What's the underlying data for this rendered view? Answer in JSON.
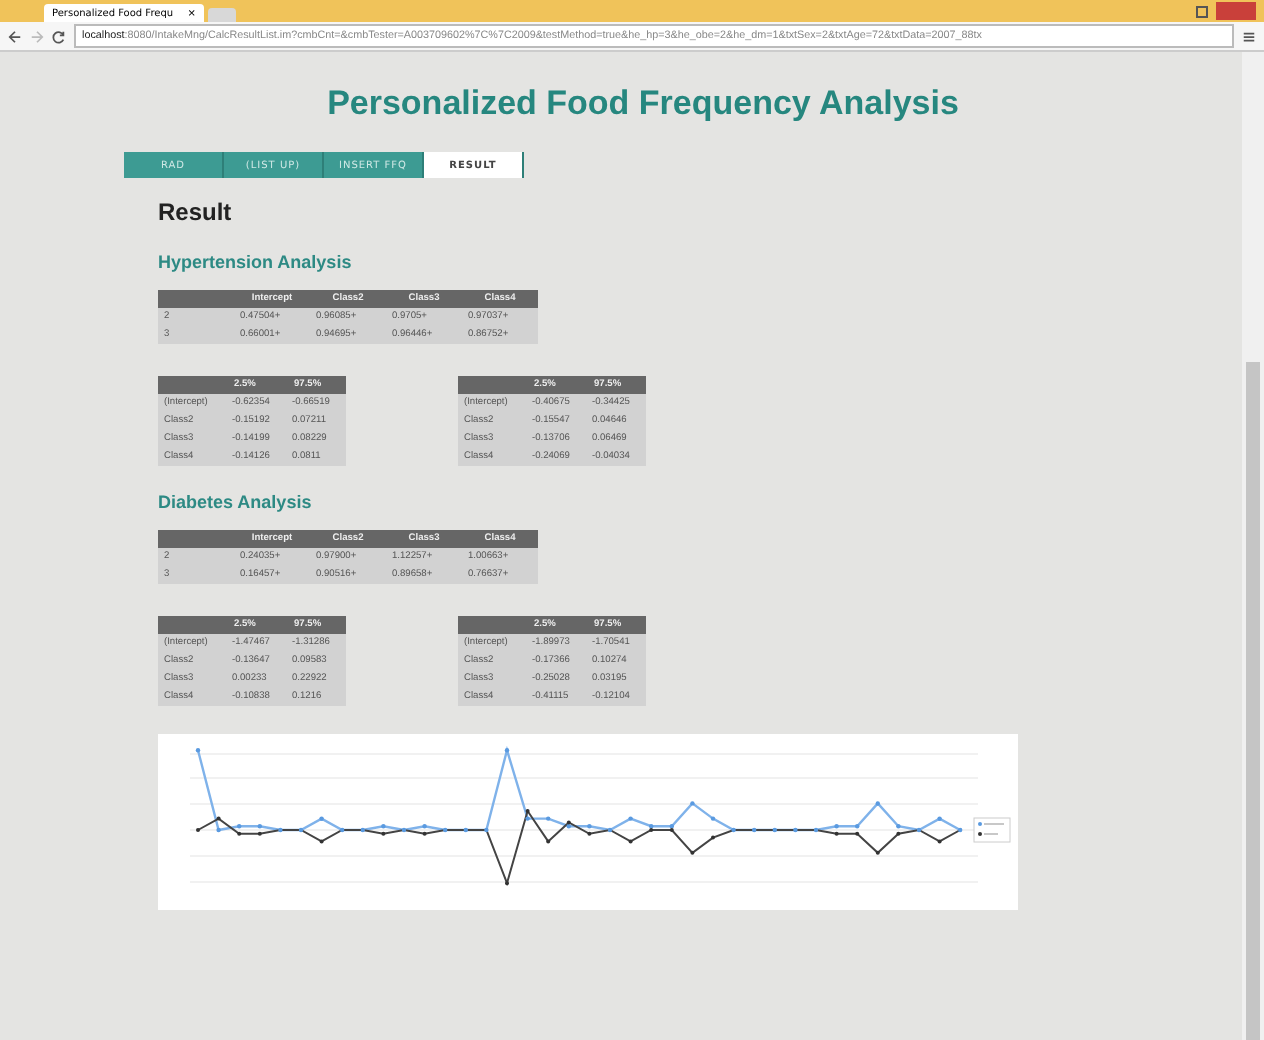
{
  "browser": {
    "tab_title": "Personalized Food Frequ",
    "tab_close": "×",
    "url_host": "localhost",
    "url_rest": ":8080/IntakeMng/CalcResultList.im?cmbCnt=&cmbTester=A003709602%7C%7C2009&testMethod=true&he_hp=3&he_obe=2&he_dm=1&txtSex=2&txtAge=72&txtData=2007_88tx"
  },
  "page": {
    "title": "Personalized Food Frequency Analysis",
    "tabs": [
      {
        "label": "RAD",
        "selected": false
      },
      {
        "label": "(LIST UP)",
        "selected": false
      },
      {
        "label": "INSERT FFQ",
        "selected": false
      },
      {
        "label": "RESULT",
        "selected": true
      }
    ],
    "heading": "Result",
    "sections": [
      {
        "title": "Hypertension Analysis",
        "coef_table": {
          "columns": [
            "Intercept",
            "Class2",
            "Class3",
            "Class4"
          ],
          "rows": [
            {
              "label": "2",
              "values": [
                "0.47504+",
                "0.96085+",
                "0.9705+",
                "0.97037+"
              ]
            },
            {
              "label": "3",
              "values": [
                "0.66001+",
                "0.94695+",
                "0.96446+",
                "0.86752+"
              ]
            }
          ]
        },
        "ci_tables": [
          {
            "columns": [
              "2.5%",
              "97.5%"
            ],
            "rows": [
              {
                "label": "(Intercept)",
                "values": [
                  "-0.62354",
                  "-0.66519"
                ]
              },
              {
                "label": "Class2",
                "values": [
                  "-0.15192",
                  "0.07211"
                ]
              },
              {
                "label": "Class3",
                "values": [
                  "-0.14199",
                  "0.08229"
                ]
              },
              {
                "label": "Class4",
                "values": [
                  "-0.14126",
                  "0.0811"
                ]
              }
            ]
          },
          {
            "columns": [
              "2.5%",
              "97.5%"
            ],
            "rows": [
              {
                "label": "(Intercept)",
                "values": [
                  "-0.40675",
                  "-0.34425"
                ]
              },
              {
                "label": "Class2",
                "values": [
                  "-0.15547",
                  "0.04646"
                ]
              },
              {
                "label": "Class3",
                "values": [
                  "-0.13706",
                  "0.06469"
                ]
              },
              {
                "label": "Class4",
                "values": [
                  "-0.24069",
                  "-0.04034"
                ]
              }
            ]
          }
        ]
      },
      {
        "title": "Diabetes Analysis",
        "coef_table": {
          "columns": [
            "Intercept",
            "Class2",
            "Class3",
            "Class4"
          ],
          "rows": [
            {
              "label": "2",
              "values": [
                "0.24035+",
                "0.97900+",
                "1.12257+",
                "1.00663+"
              ]
            },
            {
              "label": "3",
              "values": [
                "0.16457+",
                "0.90516+",
                "0.89658+",
                "0.76637+"
              ]
            }
          ]
        },
        "ci_tables": [
          {
            "columns": [
              "2.5%",
              "97.5%"
            ],
            "rows": [
              {
                "label": "(Intercept)",
                "values": [
                  "-1.47467",
                  "-1.31286"
                ]
              },
              {
                "label": "Class2",
                "values": [
                  "-0.13647",
                  "0.09583"
                ]
              },
              {
                "label": "Class3",
                "values": [
                  "0.00233",
                  "0.22922"
                ]
              },
              {
                "label": "Class4",
                "values": [
                  "-0.10838",
                  "0.1216"
                ]
              }
            ]
          },
          {
            "columns": [
              "2.5%",
              "97.5%"
            ],
            "rows": [
              {
                "label": "(Intercept)",
                "values": [
                  "-1.89973",
                  "-1.70541"
                ]
              },
              {
                "label": "Class2",
                "values": [
                  "-0.17366",
                  "0.10274"
                ]
              },
              {
                "label": "Class3",
                "values": [
                  "-0.25028",
                  "0.03195"
                ]
              },
              {
                "label": "Class4",
                "values": [
                  "-0.41115",
                  "-0.12104"
                ]
              }
            ]
          }
        ]
      }
    ]
  }
}
